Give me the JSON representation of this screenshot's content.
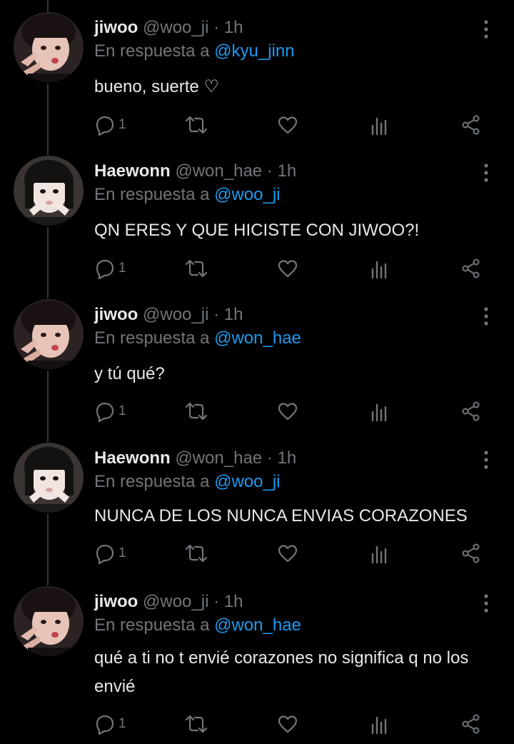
{
  "colors": {
    "background": "#000000",
    "text": "#e7e9ea",
    "muted": "#71767b",
    "link": "#1d9bf0"
  },
  "reply_prefix": "En respuesta a",
  "tweets": [
    {
      "name": "jiwoo",
      "handle": "@woo_ji",
      "sep": "·",
      "time": "1h",
      "reply_to": "@kyu_jinn",
      "text": "bueno, suerte ♡",
      "reply_count": "1"
    },
    {
      "name": "Haewonn",
      "handle": "@won_hae",
      "sep": "·",
      "time": "1h",
      "reply_to": "@woo_ji",
      "text": "QN ERES Y QUE HICISTE CON JIWOO?!",
      "reply_count": "1"
    },
    {
      "name": "jiwoo",
      "handle": "@woo_ji",
      "sep": "·",
      "time": "1h",
      "reply_to": "@won_hae",
      "text": "y tú qué?",
      "reply_count": "1"
    },
    {
      "name": "Haewonn",
      "handle": "@won_hae",
      "sep": "·",
      "time": "1h",
      "reply_to": "@woo_ji",
      "text": "NUNCA DE LOS NUNCA ENVIAS CORAZONES",
      "reply_count": "1"
    },
    {
      "name": "jiwoo",
      "handle": "@woo_ji",
      "sep": "·",
      "time": "1h",
      "reply_to": "@won_hae",
      "text": "qué a ti no t envié corazones no significa q no los envié",
      "reply_count": "1"
    }
  ]
}
